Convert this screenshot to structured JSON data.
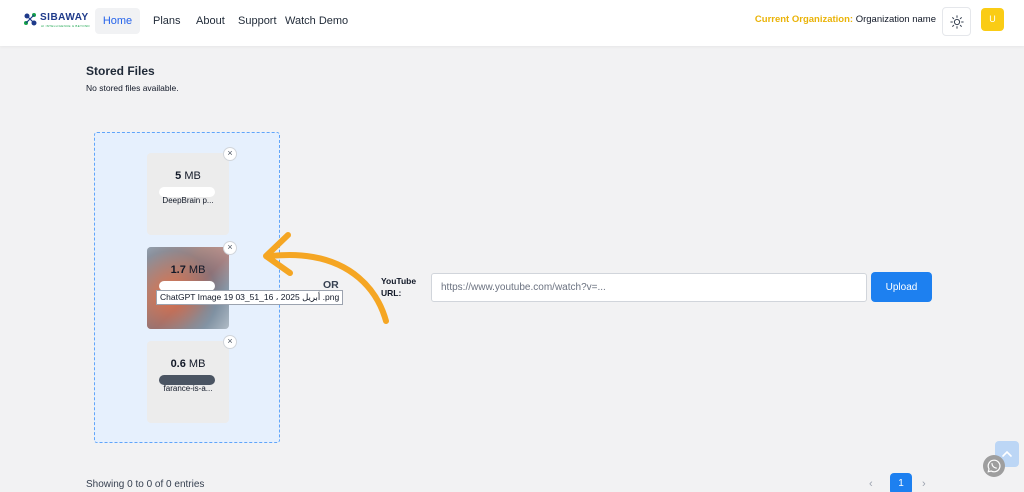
{
  "brand": {
    "name": "SIBAWAY",
    "tagline": "AI INTELLIGENCE & BEYOND"
  },
  "nav": {
    "home": "Home",
    "plans": "Plans",
    "about": "About",
    "support": "Support",
    "watch_demo": "Watch Demo"
  },
  "org": {
    "label": "Current Organization:",
    "name": "Organization name"
  },
  "user": {
    "initial": "U"
  },
  "stored": {
    "title": "Stored Files",
    "empty": "No stored files available."
  },
  "files": [
    {
      "size_num": "5",
      "size_unit": "MB",
      "name": "DeepBrain p..."
    },
    {
      "size_num": "1.7",
      "size_unit": "MB",
      "name": "ChatGPT Image 19 أبريل 2025 ، 16_51_03 .png"
    },
    {
      "size_num": "0.6",
      "size_unit": "MB",
      "name": "farance-is-a..."
    }
  ],
  "remove_glyph": "×",
  "or_text": "OR",
  "youtube": {
    "label": "YouTube URL:",
    "placeholder": "https://www.youtube.com/watch?v=...",
    "value": ""
  },
  "upload_label": "Upload",
  "table_info": "Showing 0 to 0 of 0 entries",
  "pager": {
    "prev": "‹",
    "page": "1",
    "next": "›"
  },
  "colors": {
    "accent": "#1d80f0",
    "org_label": "#eab308",
    "avatar": "#facc15",
    "dropzone_bg": "#e6f0fd",
    "arrow": "#f5a623"
  },
  "icons": {
    "theme": "sun-icon",
    "scroll": "arrow-up-icon",
    "chat": "whatsapp-icon"
  }
}
